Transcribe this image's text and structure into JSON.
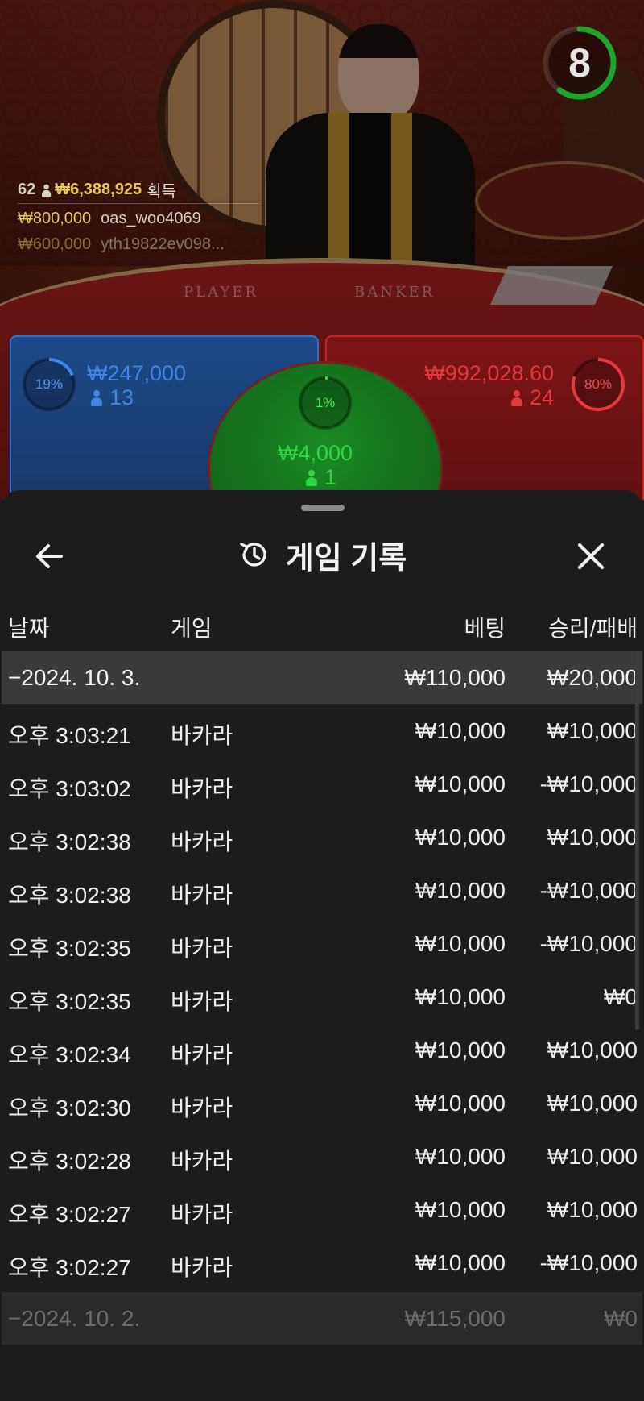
{
  "stage": {
    "timer": {
      "value": "8",
      "fraction": 0.6,
      "color": "#1fa52c"
    },
    "felt_labels": {
      "player": "PLAYER",
      "banker": "BANKER"
    },
    "winners": {
      "player_count": "62",
      "total_amount": "₩6,388,925",
      "total_label": "획득",
      "entries": [
        {
          "amount": "₩800,000",
          "user": "oas_woo4069"
        },
        {
          "amount": "₩600,000",
          "user": "yth19822ev098..."
        }
      ]
    },
    "player_spot": {
      "percent": "19%",
      "percent_value": 0.19,
      "amount": "₩247,000",
      "count": "13",
      "color": "#3f86e8"
    },
    "banker_spot": {
      "percent": "80%",
      "percent_value": 0.8,
      "amount": "₩992,028.60",
      "count": "24",
      "color": "#e23a3a"
    },
    "tie_spot": {
      "percent": "1%",
      "percent_value": 0.01,
      "amount": "₩4,000",
      "count": "1",
      "color": "#33d443"
    }
  },
  "history": {
    "title": "게임 기록",
    "icons": {
      "back": "arrow-left-icon",
      "title": "history-clock-icon",
      "close": "close-icon"
    },
    "columns": {
      "date": "날짜",
      "game": "게임",
      "bet": "베팅",
      "win_loss": "승리/패배"
    },
    "groups": [
      {
        "date": "−2024. 10. 3.",
        "bet": "₩110,000",
        "win_loss": "₩20,000",
        "rows": [
          {
            "time": "오후 3:03:21",
            "game": "바카라",
            "bet": "₩10,000",
            "win_loss": "₩10,000"
          },
          {
            "time": "오후 3:03:02",
            "game": "바카라",
            "bet": "₩10,000",
            "win_loss": "-₩10,000"
          },
          {
            "time": "오후 3:02:38",
            "game": "바카라",
            "bet": "₩10,000",
            "win_loss": "₩10,000"
          },
          {
            "time": "오후 3:02:38",
            "game": "바카라",
            "bet": "₩10,000",
            "win_loss": "-₩10,000"
          },
          {
            "time": "오후 3:02:35",
            "game": "바카라",
            "bet": "₩10,000",
            "win_loss": "-₩10,000"
          },
          {
            "time": "오후 3:02:35",
            "game": "바카라",
            "bet": "₩10,000",
            "win_loss": "₩0"
          },
          {
            "time": "오후 3:02:34",
            "game": "바카라",
            "bet": "₩10,000",
            "win_loss": "₩10,000"
          },
          {
            "time": "오후 3:02:30",
            "game": "바카라",
            "bet": "₩10,000",
            "win_loss": "₩10,000"
          },
          {
            "time": "오후 3:02:28",
            "game": "바카라",
            "bet": "₩10,000",
            "win_loss": "₩10,000"
          },
          {
            "time": "오후 3:02:27",
            "game": "바카라",
            "bet": "₩10,000",
            "win_loss": "₩10,000"
          },
          {
            "time": "오후 3:02:27",
            "game": "바카라",
            "bet": "₩10,000",
            "win_loss": "-₩10,000"
          }
        ]
      },
      {
        "date": "−2024. 10. 2.",
        "bet": "₩115,000",
        "win_loss": "₩0",
        "rows": []
      }
    ]
  }
}
